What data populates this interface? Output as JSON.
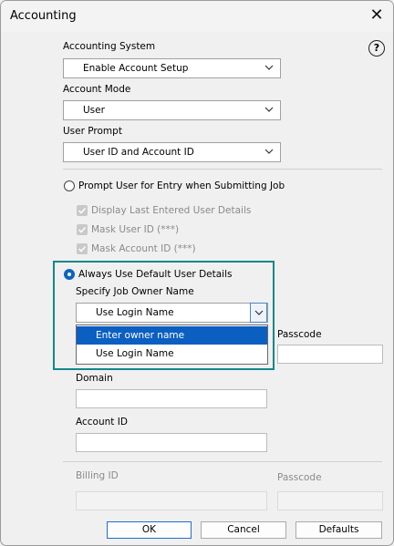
{
  "window": {
    "title": "Accounting"
  },
  "labels": {
    "accounting_system": "Accounting System",
    "account_mode": "Account Mode",
    "user_prompt": "User Prompt",
    "prompt_user_entry": "Prompt User for Entry when Submitting Job",
    "display_last": "Display Last Entered User Details",
    "mask_user_id": "Mask User ID (***)",
    "mask_account_id": "Mask Account ID (***)",
    "always_use_default": "Always Use Default User Details",
    "specify_owner": "Specify Job Owner Name",
    "passcode": "Passcode",
    "domain": "Domain",
    "account_id": "Account ID",
    "billing_id": "Billing ID",
    "passcode2": "Passcode"
  },
  "selects": {
    "accounting_system": "Enable Account Setup",
    "account_mode": "User",
    "user_prompt": "User ID and Account ID",
    "owner_name": "Use Login Name"
  },
  "dropdown_options": [
    "Enter owner name",
    "Use Login Name"
  ],
  "buttons": {
    "ok": "OK",
    "cancel": "Cancel",
    "defaults": "Defaults"
  },
  "icons": {
    "help": "?",
    "close": "✕"
  },
  "colors": {
    "accent": "#0b5fc1",
    "highlight_border": "#14888a"
  }
}
